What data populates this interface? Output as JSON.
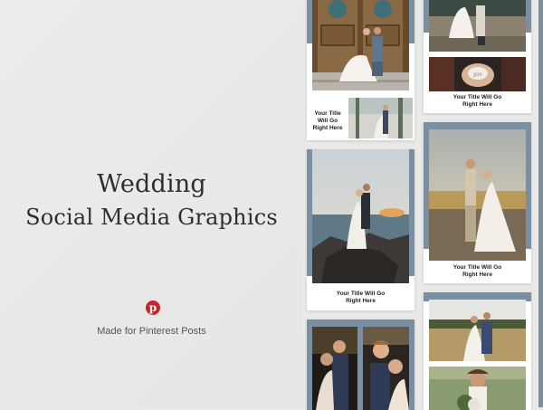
{
  "headline": {
    "line1": "Wedding",
    "line2": "Social Media Graphics"
  },
  "pinterest": {
    "icon": "pinterest-icon",
    "glyph": "p",
    "color": "#c8232c"
  },
  "subtitle": "Made for Pinterest Posts",
  "accent_color": "#7b8fa2",
  "template_caption": [
    "Your Title",
    "Will Go",
    "Right Here"
  ],
  "template_caption_wide": [
    "Your Title Will Go",
    "Right Here"
  ]
}
